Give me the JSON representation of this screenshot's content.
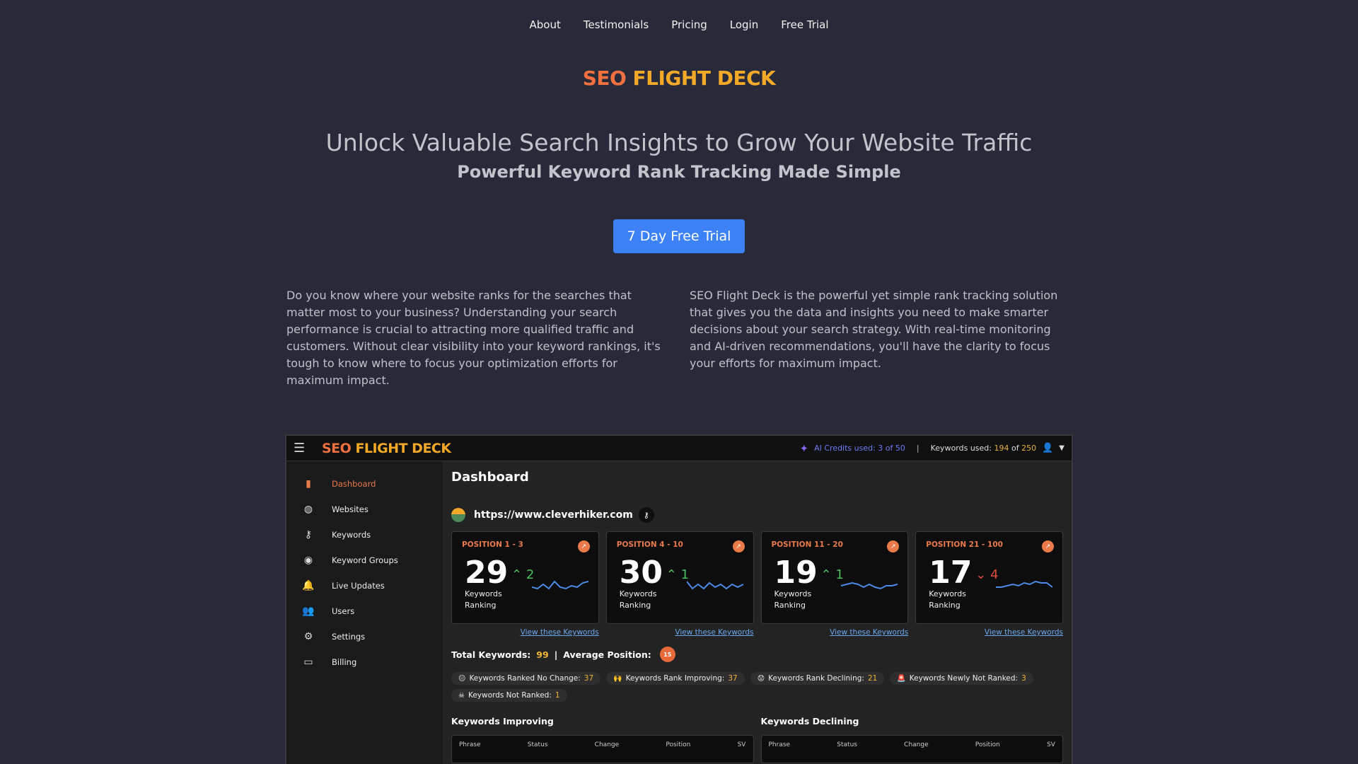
{
  "nav": {
    "items": [
      "About",
      "Testimonials",
      "Pricing",
      "Login",
      "Free Trial"
    ]
  },
  "brand": {
    "part1": "SEO",
    "part2": "FLIGHT DECK"
  },
  "hero": {
    "headline": "Unlock Valuable Search Insights to Grow Your Website Traffic",
    "subhead": "Powerful Keyword Rank Tracking Made Simple",
    "cta": "7 Day Free Trial"
  },
  "intro": {
    "left": "Do you know where your website ranks for the searches that matter most to your business? Understanding your search performance is crucial to attracting more qualified traffic and customers. Without clear visibility into your keyword rankings, it's tough to know where to focus your optimization efforts for maximum impact.",
    "right": "SEO Flight Deck is the powerful yet simple rank tracking solution that gives you the data and insights you need to make smarter decisions about your search strategy. With real-time monitoring and AI-driven recommendations, you'll have the clarity to focus your efforts for maximum impact."
  },
  "app": {
    "ai_credits": "AI Credits used: 3 of 50",
    "keywords_used_label": "Keywords used:",
    "keywords_used_num": "194",
    "keywords_of": "of",
    "keywords_total": "250",
    "sidebar": [
      {
        "label": "Dashboard",
        "icon": "bar-chart-icon",
        "active": true
      },
      {
        "label": "Websites",
        "icon": "globe-icon"
      },
      {
        "label": "Keywords",
        "icon": "key-icon"
      },
      {
        "label": "Keyword Groups",
        "icon": "group-icon"
      },
      {
        "label": "Live Updates",
        "icon": "bell-icon"
      },
      {
        "label": "Users",
        "icon": "users-icon"
      },
      {
        "label": "Settings",
        "icon": "gear-icon"
      },
      {
        "label": "Billing",
        "icon": "card-icon"
      }
    ],
    "dashboard_title": "Dashboard",
    "site_url": "https://www.cleverhiker.com",
    "cards": [
      {
        "label": "POSITION 1 - 3",
        "count": "29",
        "delta": "2",
        "direction": "up",
        "sub": "Keywords Ranking",
        "link": "View these Keywords"
      },
      {
        "label": "POSITION 4 - 10",
        "count": "30",
        "delta": "1",
        "direction": "up",
        "sub": "Keywords Ranking",
        "link": "View these Keywords"
      },
      {
        "label": "POSITION 11 - 20",
        "count": "19",
        "delta": "1",
        "direction": "up",
        "sub": "Keywords Ranking",
        "link": "View these Keywords"
      },
      {
        "label": "POSITION 21 - 100",
        "count": "17",
        "delta": "4",
        "direction": "down",
        "sub": "Keywords Ranking",
        "link": "View these Keywords"
      }
    ],
    "totals": {
      "total_label": "Total Keywords:",
      "total_value": "99",
      "divider": "|",
      "avg_label": "Average Position:",
      "avg_value": "15"
    },
    "chips": [
      {
        "label": "Keywords Ranked No Change:",
        "value": "37",
        "emoji": "😐"
      },
      {
        "label": "Keywords Rank Improving:",
        "value": "37",
        "emoji": "🙌"
      },
      {
        "label": "Keywords Rank Declining:",
        "value": "21",
        "emoji": "😟"
      },
      {
        "label": "Keywords Newly Not Ranked:",
        "value": "3",
        "emoji": "🚨"
      },
      {
        "label": "Keywords Not Ranked:",
        "value": "1",
        "emoji": "☠"
      }
    ],
    "lists": [
      {
        "title": "Keywords Improving",
        "cols": [
          "Phrase",
          "Status",
          "Change",
          "Position",
          "SV"
        ]
      },
      {
        "title": "Keywords Declining",
        "cols": [
          "Phrase",
          "Status",
          "Change",
          "Position",
          "SV"
        ]
      }
    ],
    "colors": {
      "accent": "#ea7a4a",
      "gold": "#f3a928",
      "cta": "#3c82f6",
      "up": "#4bbf5c",
      "down": "#e04b3c"
    }
  }
}
